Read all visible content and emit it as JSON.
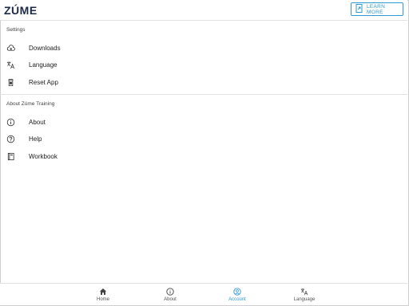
{
  "header": {
    "logo_text": "ZÚME",
    "learn_more_label": "LEARN MORE"
  },
  "settings": {
    "section_title": "Settings",
    "items": [
      {
        "label": "Downloads",
        "icon": "cloud-download-icon"
      },
      {
        "label": "Language",
        "icon": "translate-icon"
      },
      {
        "label": "Reset App",
        "icon": "trash-icon"
      }
    ]
  },
  "about_section": {
    "section_title": "About Zúme Training",
    "items": [
      {
        "label": "About",
        "icon": "info-icon"
      },
      {
        "label": "Help",
        "icon": "help-icon"
      },
      {
        "label": "Workbook",
        "icon": "book-icon"
      }
    ]
  },
  "bottom_nav": {
    "active": "Account",
    "items": [
      {
        "label": "Home",
        "icon": "home-icon"
      },
      {
        "label": "About",
        "icon": "info-icon"
      },
      {
        "label": "Account",
        "icon": "account-icon"
      },
      {
        "label": "Language",
        "icon": "translate-icon"
      }
    ]
  },
  "colors": {
    "accent": "#2e9ad1",
    "logo": "#1c2a48",
    "text": "#222222",
    "divider": "#e3e3e3"
  }
}
